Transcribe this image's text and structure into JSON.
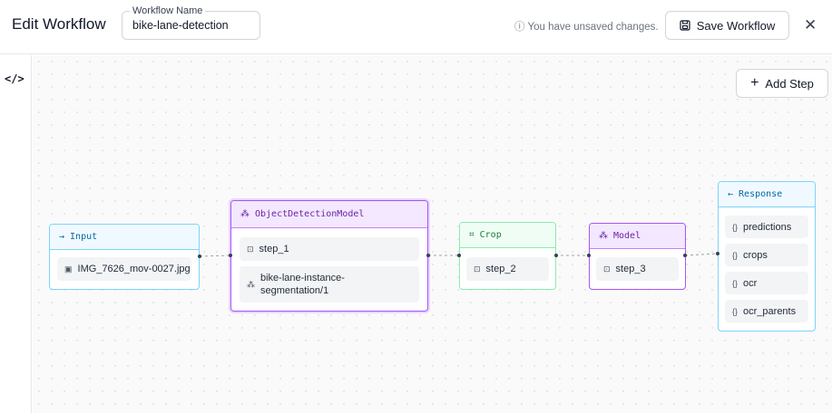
{
  "header": {
    "title": "Edit Workflow",
    "workflow_name_label": "Workflow Name",
    "workflow_name_value": "bike-lane-detection",
    "unsaved_notice": "ⓘ You have unsaved changes.",
    "save_label": "Save Workflow"
  },
  "canvas": {
    "add_step_label": "Add Step"
  },
  "nodes": {
    "input": {
      "title": "Input",
      "image": "IMG_7626_mov-0027.jpg",
      "color": "#38bdf8"
    },
    "detection": {
      "title": "ObjectDetectionModel",
      "step": "step_1",
      "model_line1": "bike-lane-instance-",
      "model_line2": "segmentation/1",
      "color": "#a855f7"
    },
    "crop": {
      "title": "Crop",
      "step": "step_2",
      "color": "#4ade80"
    },
    "model": {
      "title": "Model",
      "step": "step_3",
      "color": "#a855f7"
    },
    "response": {
      "title": "Response",
      "outputs": [
        "predictions",
        "crops",
        "ocr",
        "ocr_parents"
      ],
      "color": "#38bdf8"
    }
  }
}
